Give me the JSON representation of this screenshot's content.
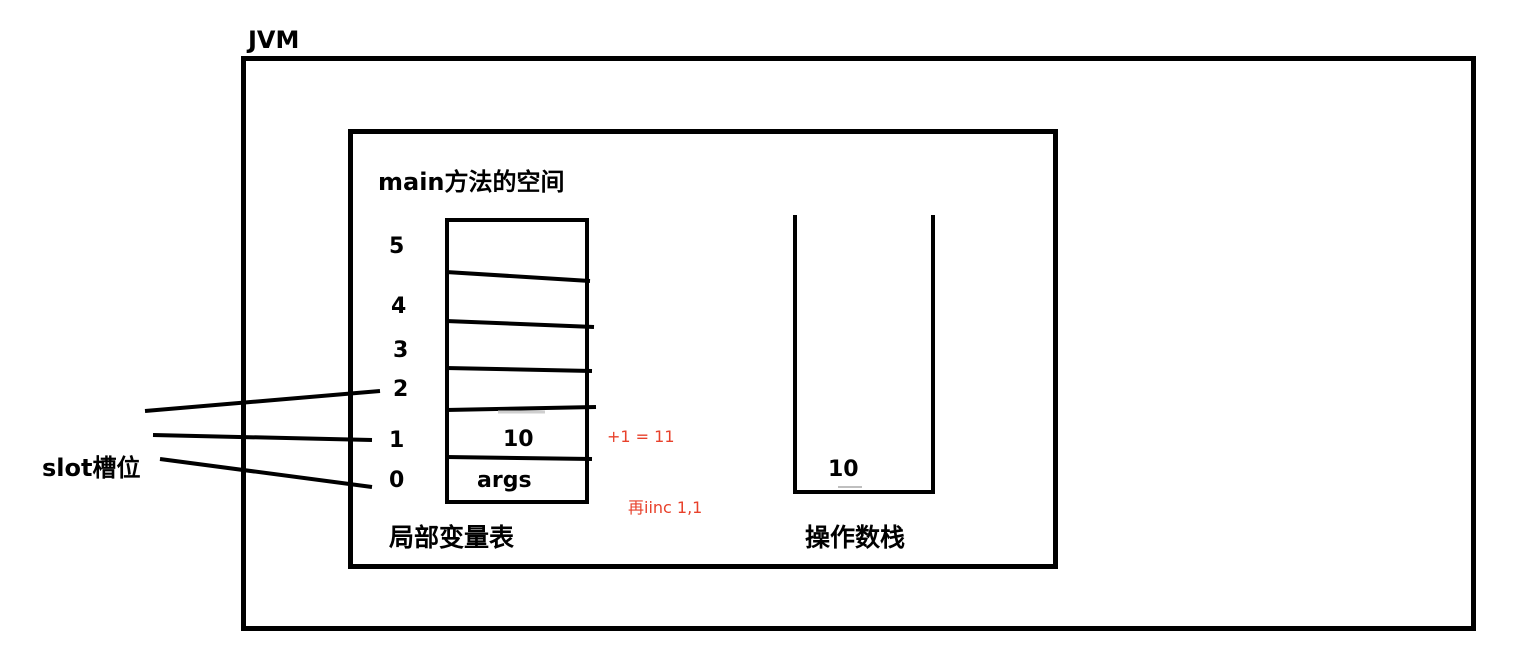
{
  "jvm": {
    "title": "JVM"
  },
  "method_frame": {
    "title": "main方法的空间"
  },
  "local_variable_table": {
    "caption": "局部变量表",
    "slot_indices": [
      "5",
      "4",
      "3",
      "2",
      "1",
      "0"
    ],
    "slot_values": {
      "slot_1": "10",
      "slot_0": "args"
    }
  },
  "slot_label": "slot槽位",
  "annotations": {
    "increment_note": "+1 = 11",
    "iinc_note": "再iinc 1,1"
  },
  "operand_stack": {
    "caption": "操作数栈",
    "top_value": "10"
  },
  "colors": {
    "stroke": "#000000",
    "annotation": "#e8412b"
  }
}
